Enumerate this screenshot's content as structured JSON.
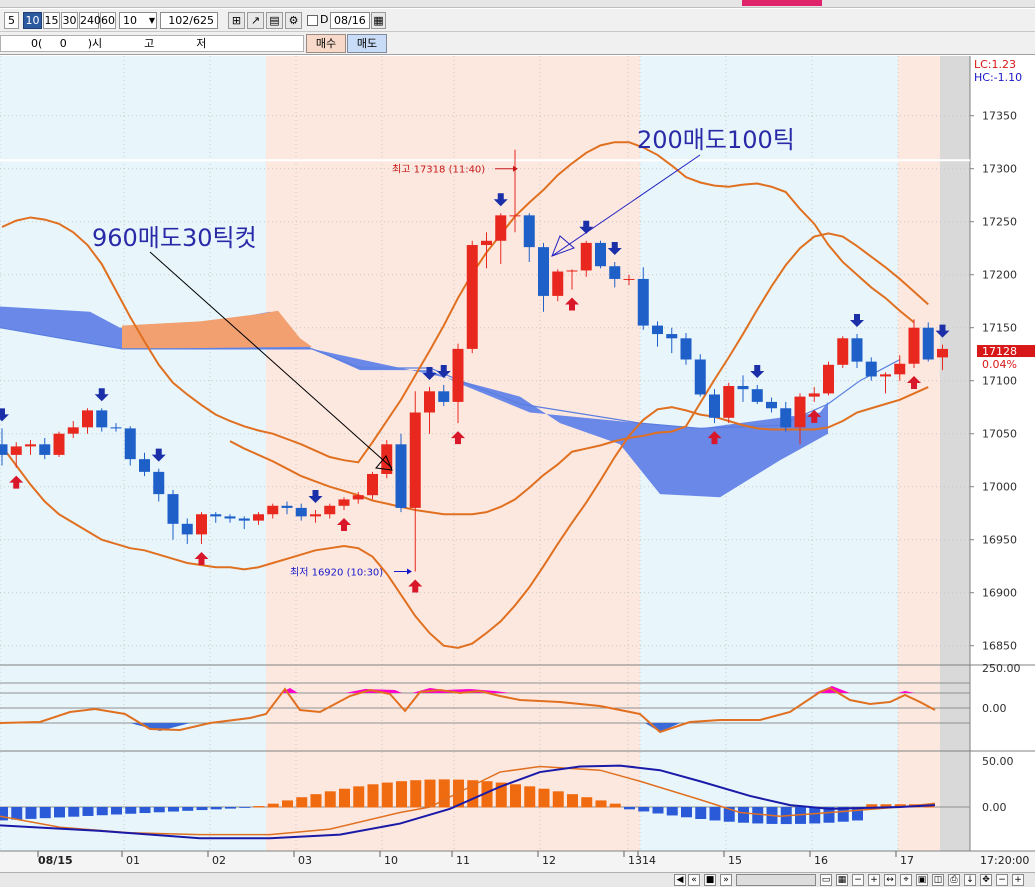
{
  "toolbar": {
    "periods": [
      "5",
      "10",
      "15",
      "30",
      "240",
      "60"
    ],
    "selected_period": "10",
    "interval_value": "10",
    "count_display": "102/625",
    "date_value": "08/16",
    "date_checkbox_label": "D"
  },
  "order_bar": {
    "quote_text": "0(     0      )시            고            저",
    "buy_label": "매수",
    "sell_label": "매도"
  },
  "colors": {
    "up_candle": "#e8281e",
    "down_candle": "#1e5fc8",
    "bollinger": "#e07020",
    "cloud_blue": "#6a88e8",
    "cloud_orange": "#f3a070",
    "session_red_bg": "#fde8e0",
    "session_blue_bg": "#e8f6fc",
    "osc_magenta": "#ff00cc",
    "macd_line": "#1a1aa8"
  },
  "chart_data": {
    "type": "candlestick",
    "y_axis": {
      "ticks": [
        16850,
        16900,
        16950,
        17000,
        17050,
        17100,
        17150,
        17200,
        17250,
        17300,
        17350
      ]
    },
    "x_labels": [
      "08/15",
      "01",
      "02",
      "03",
      "10",
      "11",
      "12",
      "13",
      "14",
      "15",
      "16",
      "17"
    ],
    "time_label": "17:20:00",
    "lc_label": "LC:1.23",
    "hc_label": "HC:-1.10",
    "current_price": "17128",
    "current_change": "0.04%",
    "high_annotation": "최고 17318 (11:40)",
    "low_annotation": "최저 16920 (10:30)",
    "note_1": "960매도30틱컷",
    "note_2": "200매도100틱",
    "horizontal_line": 17308,
    "candles": [
      {
        "o": 17040,
        "h": 17055,
        "l": 17020,
        "c": 17030
      },
      {
        "o": 17030,
        "h": 17042,
        "l": 17018,
        "c": 17038
      },
      {
        "o": 17038,
        "h": 17044,
        "l": 17030,
        "c": 17040
      },
      {
        "o": 17040,
        "h": 17046,
        "l": 17026,
        "c": 17030
      },
      {
        "o": 17030,
        "h": 17052,
        "l": 17028,
        "c": 17050
      },
      {
        "o": 17050,
        "h": 17062,
        "l": 17046,
        "c": 17056
      },
      {
        "o": 17056,
        "h": 17074,
        "l": 17050,
        "c": 17072
      },
      {
        "o": 17072,
        "h": 17074,
        "l": 17052,
        "c": 17056
      },
      {
        "o": 17056,
        "h": 17060,
        "l": 17052,
        "c": 17055
      },
      {
        "o": 17055,
        "h": 17057,
        "l": 17020,
        "c": 17026
      },
      {
        "o": 17026,
        "h": 17032,
        "l": 17010,
        "c": 17014
      },
      {
        "o": 17014,
        "h": 17017,
        "l": 16986,
        "c": 16993
      },
      {
        "o": 16993,
        "h": 16997,
        "l": 16950,
        "c": 16965
      },
      {
        "o": 16965,
        "h": 16970,
        "l": 16946,
        "c": 16955
      },
      {
        "o": 16955,
        "h": 16976,
        "l": 16946,
        "c": 16974
      },
      {
        "o": 16974,
        "h": 16976,
        "l": 16966,
        "c": 16972
      },
      {
        "o": 16972,
        "h": 16974,
        "l": 16966,
        "c": 16970
      },
      {
        "o": 16970,
        "h": 16972,
        "l": 16960,
        "c": 16968
      },
      {
        "o": 16968,
        "h": 16976,
        "l": 16964,
        "c": 16974
      },
      {
        "o": 16974,
        "h": 16984,
        "l": 16970,
        "c": 16982
      },
      {
        "o": 16982,
        "h": 16986,
        "l": 16974,
        "c": 16980
      },
      {
        "o": 16980,
        "h": 16984,
        "l": 16968,
        "c": 16972
      },
      {
        "o": 16972,
        "h": 16978,
        "l": 16966,
        "c": 16974
      },
      {
        "o": 16974,
        "h": 16984,
        "l": 16970,
        "c": 16982
      },
      {
        "o": 16982,
        "h": 16990,
        "l": 16978,
        "c": 16988
      },
      {
        "o": 16988,
        "h": 16995,
        "l": 16984,
        "c": 16992
      },
      {
        "o": 16992,
        "h": 17014,
        "l": 16988,
        "c": 17012
      },
      {
        "o": 17012,
        "h": 17044,
        "l": 17008,
        "c": 17040
      },
      {
        "o": 17040,
        "h": 17050,
        "l": 16976,
        "c": 16980
      },
      {
        "o": 16980,
        "h": 17090,
        "l": 16920,
        "c": 17070
      },
      {
        "o": 17070,
        "h": 17094,
        "l": 17050,
        "c": 17090
      },
      {
        "o": 17090,
        "h": 17096,
        "l": 17076,
        "c": 17080
      },
      {
        "o": 17080,
        "h": 17135,
        "l": 17060,
        "c": 17130
      },
      {
        "o": 17130,
        "h": 17232,
        "l": 17126,
        "c": 17228
      },
      {
        "o": 17228,
        "h": 17240,
        "l": 17206,
        "c": 17232
      },
      {
        "o": 17232,
        "h": 17258,
        "l": 17210,
        "c": 17256
      },
      {
        "o": 17256,
        "h": 17318,
        "l": 17240,
        "c": 17256
      },
      {
        "o": 17256,
        "h": 17258,
        "l": 17212,
        "c": 17226
      },
      {
        "o": 17226,
        "h": 17230,
        "l": 17165,
        "c": 17180
      },
      {
        "o": 17180,
        "h": 17205,
        "l": 17175,
        "c": 17203
      },
      {
        "o": 17203,
        "h": 17205,
        "l": 17186,
        "c": 17204
      },
      {
        "o": 17204,
        "h": 17232,
        "l": 17198,
        "c": 17230
      },
      {
        "o": 17230,
        "h": 17232,
        "l": 17206,
        "c": 17208
      },
      {
        "o": 17208,
        "h": 17212,
        "l": 17188,
        "c": 17196
      },
      {
        "o": 17196,
        "h": 17200,
        "l": 17190,
        "c": 17196
      },
      {
        "o": 17196,
        "h": 17207,
        "l": 17148,
        "c": 17152
      },
      {
        "o": 17152,
        "h": 17156,
        "l": 17132,
        "c": 17144
      },
      {
        "o": 17144,
        "h": 17150,
        "l": 17126,
        "c": 17140
      },
      {
        "o": 17140,
        "h": 17145,
        "l": 17115,
        "c": 17120
      },
      {
        "o": 17120,
        "h": 17125,
        "l": 17085,
        "c": 17087
      },
      {
        "o": 17087,
        "h": 17092,
        "l": 17060,
        "c": 17065
      },
      {
        "o": 17065,
        "h": 17098,
        "l": 17060,
        "c": 17095
      },
      {
        "o": 17095,
        "h": 17105,
        "l": 17080,
        "c": 17092
      },
      {
        "o": 17092,
        "h": 17096,
        "l": 17078,
        "c": 17080
      },
      {
        "o": 17080,
        "h": 17084,
        "l": 17070,
        "c": 17074
      },
      {
        "o": 17074,
        "h": 17080,
        "l": 17052,
        "c": 17056
      },
      {
        "o": 17056,
        "h": 17088,
        "l": 17040,
        "c": 17085
      },
      {
        "o": 17085,
        "h": 17094,
        "l": 17080,
        "c": 17088
      },
      {
        "o": 17088,
        "h": 17118,
        "l": 17086,
        "c": 17115
      },
      {
        "o": 17115,
        "h": 17142,
        "l": 17112,
        "c": 17140
      },
      {
        "o": 17140,
        "h": 17144,
        "l": 17112,
        "c": 17118
      },
      {
        "o": 17118,
        "h": 17122,
        "l": 17100,
        "c": 17104
      },
      {
        "o": 17104,
        "h": 17108,
        "l": 17088,
        "c": 17106
      },
      {
        "o": 17106,
        "h": 17124,
        "l": 17100,
        "c": 17116
      },
      {
        "o": 17116,
        "h": 17158,
        "l": 17112,
        "c": 17150
      },
      {
        "o": 17150,
        "h": 17155,
        "l": 17118,
        "c": 17120
      },
      {
        "o": 17122,
        "h": 17134,
        "l": 17110,
        "c": 17130
      }
    ],
    "sell_signals": [
      0,
      7,
      11,
      22,
      30,
      31,
      35,
      41,
      43,
      53,
      60,
      66
    ],
    "buy_signals": [
      1,
      14,
      24,
      29,
      32,
      40,
      50,
      57,
      64
    ],
    "bollinger_upper": [
      17245,
      17251,
      17254,
      17252,
      17248,
      17240,
      17228,
      17210,
      17185,
      17160,
      17137,
      17115,
      17098,
      17087,
      17077,
      17068,
      17062,
      17057,
      17053,
      17050,
      17045,
      17040,
      17034,
      17028,
      17025,
      17023,
      17042,
      17062,
      17082,
      17105,
      17128,
      17152,
      17178,
      17201,
      17221,
      17238,
      17255,
      17268,
      17280,
      17294,
      17305,
      17315,
      17322,
      17325,
      17325,
      17320,
      17313,
      17303,
      17292,
      17287,
      17284,
      17283,
      17285,
      17286,
      17283,
      17278,
      17262,
      17248,
      17228,
      17212,
      17200,
      17188,
      17178,
      17166,
      17155
    ],
    "bollinger_mid": [
      17043,
      17036,
      17030,
      17024,
      17017,
      17010,
      17005,
      17000,
      16996,
      16992,
      16987,
      16984,
      16981,
      16978,
      16976,
      16974,
      16974,
      16974,
      16976,
      16981,
      16988,
      16999,
      17011,
      17021,
      17033,
      17036,
      17039,
      17043,
      17046,
      17048,
      17051,
      17052,
      17057,
      17079,
      17101,
      17122,
      17144,
      17167,
      17189,
      17209,
      17225,
      17236,
      17239,
      17236,
      17227,
      17217,
      17207,
      17196,
      17184,
      17172
    ],
    "bollinger_lower": [
      17038,
      17020,
      17002,
      16986,
      16974,
      16966,
      16958,
      16950,
      16946,
      16942,
      16940,
      16936,
      16932,
      16928,
      16926,
      16924,
      16924,
      16922,
      16924,
      16928,
      16932,
      16936,
      16940,
      16942,
      16944,
      16942,
      16934,
      16918,
      16898,
      16878,
      16862,
      16850,
      16848,
      16852,
      16862,
      16873,
      16888,
      16905,
      16925,
      16946,
      16966,
      16985,
      17006,
      17028,
      17048,
      17063,
      17073,
      17075,
      17072,
      17068,
      17066,
      17062,
      17058,
      17055,
      17054,
      17054,
      17054,
      17054,
      17056,
      17062,
      17070,
      17074,
      17078,
      17082,
      17088,
      17094
    ]
  },
  "oscillator": {
    "scale_top": "250.00",
    "scale_zero": "0.00"
  },
  "macd": {
    "scale_top": "50.00",
    "scale_zero": "0.00"
  }
}
